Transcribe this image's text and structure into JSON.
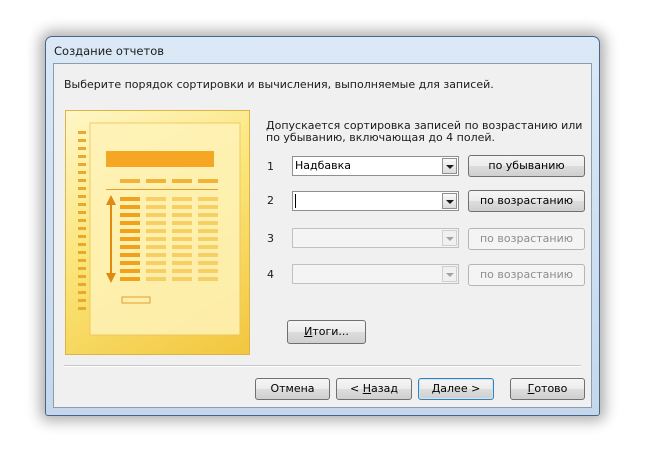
{
  "window": {
    "title": "Создание отчетов",
    "instruction": "Выберите порядок сортировки и вычисления, выполняемые для записей.",
    "description": "Допускается сортировка записей по возрастанию или по убыванию, включающая до 4 полей."
  },
  "sort_rows": [
    {
      "number": "1",
      "field_value": "Надбавка",
      "order_label": "по убыванию",
      "enabled": true
    },
    {
      "number": "2",
      "field_value": "",
      "order_label": "по возрастанию",
      "enabled": true,
      "focused": true
    },
    {
      "number": "3",
      "field_value": "",
      "order_label": "по возрастанию",
      "enabled": false
    },
    {
      "number": "4",
      "field_value": "",
      "order_label": "по возрастанию",
      "enabled": false
    }
  ],
  "summary_button": {
    "mnemonic": "И",
    "rest": "тоги..."
  },
  "footer": {
    "cancel": "Отмена",
    "back_prefix": "< ",
    "back_mnemonic": "Н",
    "back_rest": "азад",
    "next_mnemonic": "Д",
    "next_rest": "алее >",
    "finish_mnemonic": "Г",
    "finish_rest": "отово"
  }
}
